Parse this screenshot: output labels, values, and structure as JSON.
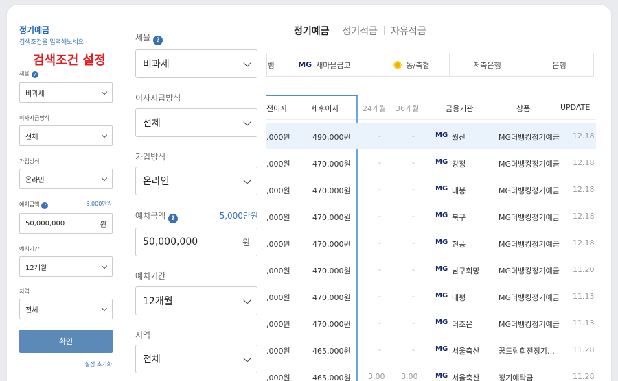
{
  "top_tabs": [
    "정기예금",
    "정기적금",
    "자유적금"
  ],
  "bank_tabs": [
    {
      "label": "뱅",
      "prefix": ""
    },
    {
      "label": "새마을금고",
      "prefix": "MG"
    },
    {
      "label": "농/축협",
      "prefix": ""
    },
    {
      "label": "저축은행",
      "prefix": ""
    },
    {
      "label": "은행",
      "prefix": ""
    }
  ],
  "table": {
    "headers": {
      "pre_interest": "전이자",
      "post_interest": "세후이자",
      "m24": "24개월",
      "m36": "36개월",
      "institution": "금융기관",
      "product": "상품",
      "update": "UPDATE"
    },
    "rows": [
      {
        "pre": ",000원",
        "post": "490,000원",
        "c24": "-",
        "c36": "-",
        "mg": "MG",
        "inst": "월산",
        "product": "MG더뱅킹정기예금",
        "date": "12.18"
      },
      {
        "pre": ",000원",
        "post": "470,000원",
        "c24": "-",
        "c36": "-",
        "mg": "MG",
        "inst": "강정",
        "product": "MG더뱅킹정기예금",
        "date": "12.18"
      },
      {
        "pre": ",000원",
        "post": "470,000원",
        "c24": "-",
        "c36": "-",
        "mg": "MG",
        "inst": "대봉",
        "product": "MG더뱅킹정기예금",
        "date": "12.18"
      },
      {
        "pre": ",000원",
        "post": "470,000원",
        "c24": "-",
        "c36": "-",
        "mg": "MG",
        "inst": "북구",
        "product": "MG더뱅킹정기예금",
        "date": "12.18"
      },
      {
        "pre": ",000원",
        "post": "470,000원",
        "c24": "-",
        "c36": "-",
        "mg": "MG",
        "inst": "현풍",
        "product": "MG더뱅킹정기예금",
        "date": "12.18"
      },
      {
        "pre": ",000원",
        "post": "470,000원",
        "c24": "-",
        "c36": "-",
        "mg": "MG",
        "inst": "남구희망",
        "product": "MG더뱅킹정기예금",
        "date": "11.20"
      },
      {
        "pre": ",000원",
        "post": "470,000원",
        "c24": "-",
        "c36": "-",
        "mg": "MG",
        "inst": "대평",
        "product": "MG더뱅킹정기예금",
        "date": "11.13"
      },
      {
        "pre": ",000원",
        "post": "470,000원",
        "c24": "-",
        "c36": "-",
        "mg": "MG",
        "inst": "더조은",
        "product": "MG더뱅킹정기예금",
        "date": "11.13"
      },
      {
        "pre": ",000원",
        "post": "465,000원",
        "c24": "-",
        "c36": "-",
        "mg": "MG",
        "inst": "서울축산",
        "product": "꿈드림희전정기…",
        "date": "11.28"
      },
      {
        "pre": ",000원",
        "post": "465,000원",
        "c24": "3.00",
        "c36": "3.00",
        "mg": "MG",
        "inst": "서울축산",
        "product": "정기예탁금",
        "date": "11.28"
      }
    ]
  },
  "sidebar": {
    "title": "정기예금",
    "subtitle": "검색조건을 입력해보세요",
    "overlay_title": "검색조건 설정",
    "tax_label": "세율",
    "tax_value": "비과세",
    "interest_label": "이자지급방식",
    "interest_value": "전체",
    "join_label": "가입방식",
    "join_value": "온라인",
    "amount_label": "예치금액",
    "amount_hint": "5,000만원",
    "amount_value": "50,000,000",
    "amount_unit": "원",
    "period_label": "예치기간",
    "period_value": "12개월",
    "region_label": "지역",
    "region_value": "전체",
    "confirm": "확인",
    "reset": "설정 초기화"
  },
  "zoom": {
    "tax_label": "세율",
    "tax_value": "비과세",
    "interest_label": "이자지급방식",
    "interest_value": "전체",
    "join_label": "가입방식",
    "join_value": "온라인",
    "amount_label": "예치금액",
    "amount_hint": "5,000만원",
    "amount_value": "50,000,000",
    "amount_unit": "원",
    "period_label": "예치기간",
    "period_value": "12개월",
    "region_label": "지역",
    "region_value": "전체"
  },
  "help_glyph": "?"
}
